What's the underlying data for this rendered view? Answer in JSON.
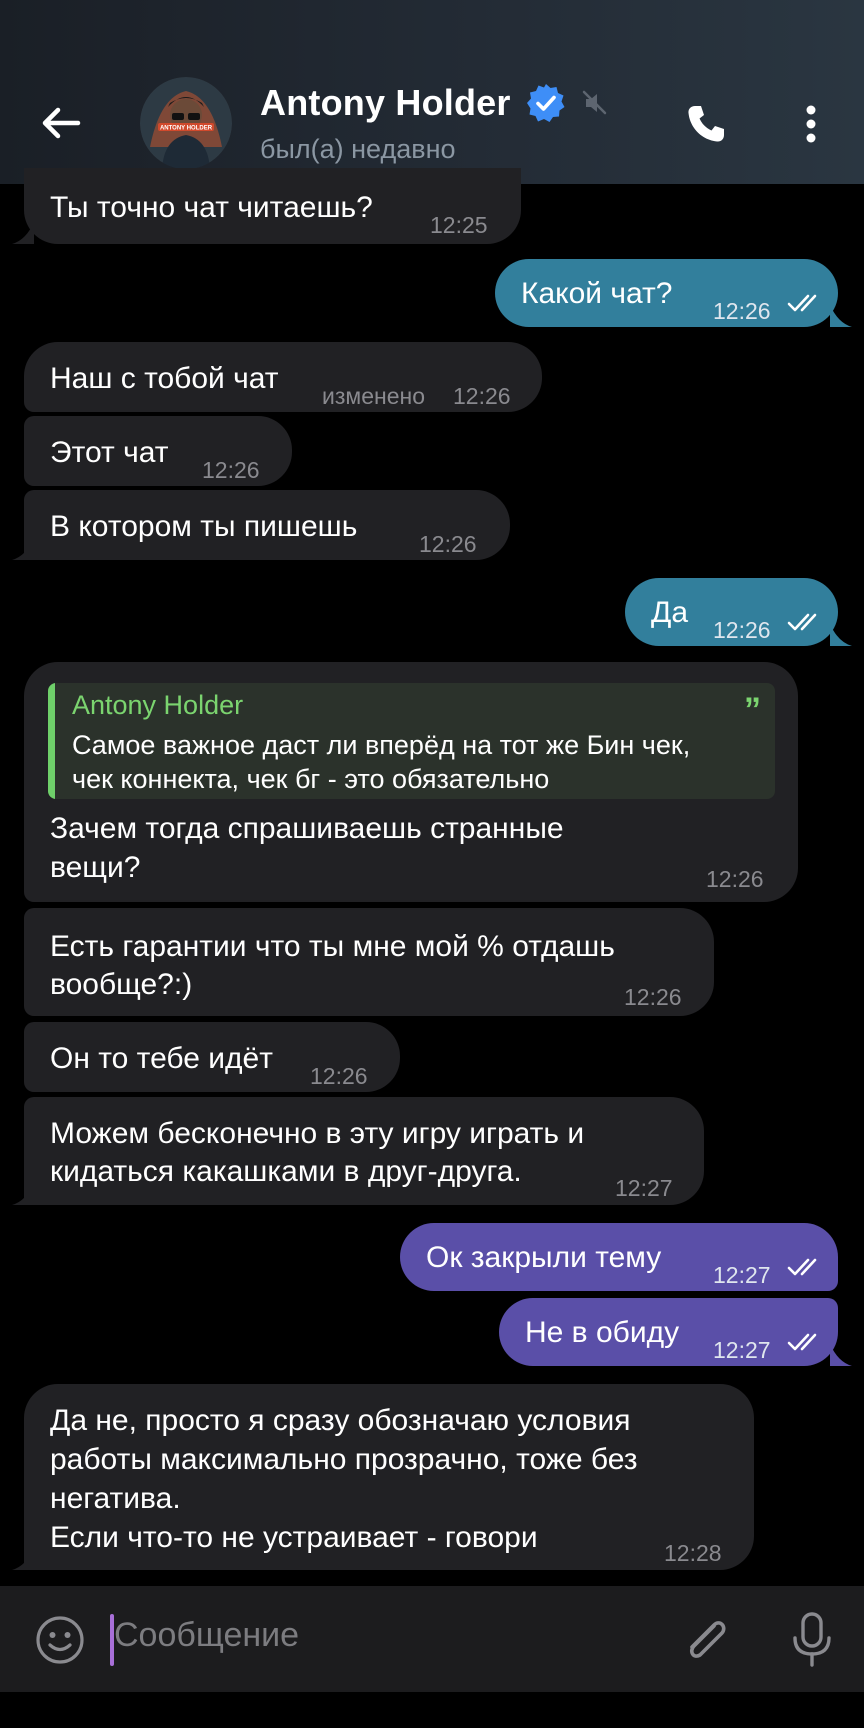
{
  "header": {
    "contact_name": "Antony Holder",
    "status": "был(а) недавно",
    "avatar_text": "ANTONY HOLDER"
  },
  "messages": [
    {
      "dir": "in",
      "text": "Ты точно чат читаешь?",
      "time": "12:25"
    },
    {
      "dir": "out",
      "text": "Какой чат?",
      "time": "12:26"
    },
    {
      "dir": "in",
      "text": "Наш с тобой чат",
      "edited": "изменено",
      "time": "12:26"
    },
    {
      "dir": "in",
      "text": "Этот чат",
      "time": "12:26"
    },
    {
      "dir": "in",
      "text": "В котором ты пишешь",
      "time": "12:26"
    },
    {
      "dir": "out",
      "text": "Да",
      "time": "12:26"
    },
    {
      "dir": "in",
      "quote": {
        "author": "Antony Holder",
        "line1": "Самое важное даст ли вперёд на тот же Бин чек,",
        "line2": "чек коннекта, чек бг - это обязательно"
      },
      "line1": "Зачем тогда спрашиваешь странные",
      "line2": "вещи?",
      "time": "12:26"
    },
    {
      "dir": "in",
      "line1": "Есть гарантии что ты мне мой % отдашь",
      "line2": "вообще?:)",
      "time": "12:26"
    },
    {
      "dir": "in",
      "text": "Он то тебе идёт",
      "time": "12:26"
    },
    {
      "dir": "in",
      "line1": "Можем бесконечно в эту игру играть и",
      "line2": "кидаться какашками в друг-друга.",
      "time": "12:27"
    },
    {
      "dir": "out",
      "text": "Ок закрыли тему",
      "time": "12:27"
    },
    {
      "dir": "out",
      "text": "Не в обиду",
      "time": "12:27"
    },
    {
      "dir": "in",
      "line1": "Да не, просто я сразу обозначаю условия",
      "line2": "работы максимально прозрачно, тоже без",
      "line3": "негатива.",
      "line4": "Если что-то не устраивает  - говори",
      "time": "12:28"
    }
  ],
  "input": {
    "placeholder": "Сообщение"
  },
  "colors": {
    "incoming_bubble": "#212124",
    "outgoing_teal": "#327f9c",
    "outgoing_purple": "#5a4fa8",
    "quote_accent": "#6fd06a",
    "verified": "#3e8ef7"
  }
}
